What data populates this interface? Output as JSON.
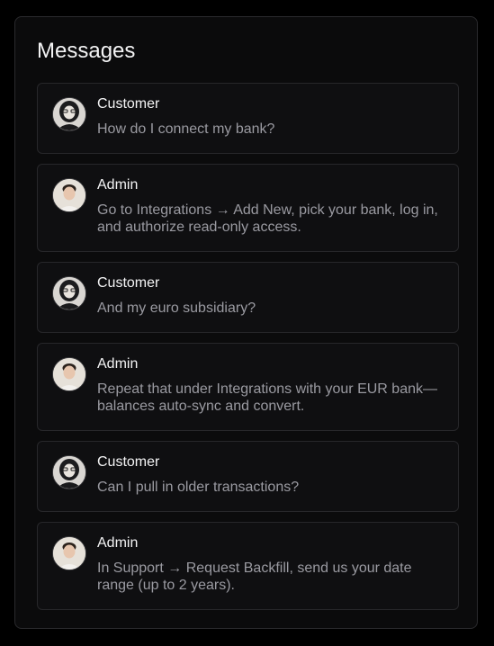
{
  "panel": {
    "title": "Messages"
  },
  "messages": [
    {
      "author": "Customer",
      "avatar": "customer-avatar",
      "text": "How do I connect my bank?"
    },
    {
      "author": "Admin",
      "avatar": "admin-avatar",
      "text": "Go to Integrations → Add New, pick your bank, log in, and authorize read-only access."
    },
    {
      "author": "Customer",
      "avatar": "customer-avatar",
      "text": "And my euro subsidiary?"
    },
    {
      "author": "Admin",
      "avatar": "admin-avatar",
      "text": "Repeat that under Integrations with your EUR bank—balances auto-sync and convert."
    },
    {
      "author": "Customer",
      "avatar": "customer-avatar",
      "text": "Can I pull in older transactions?"
    },
    {
      "author": "Admin",
      "avatar": "admin-avatar",
      "text": "In Support → Request Backfill, send us your date range (up to 2 years)."
    }
  ],
  "colors": {
    "background": "#000000",
    "panel": "#0b0b0c",
    "card": "#0f0f11",
    "border": "#27272a",
    "author": "#f4f4f5",
    "text": "#9a9aa1"
  }
}
